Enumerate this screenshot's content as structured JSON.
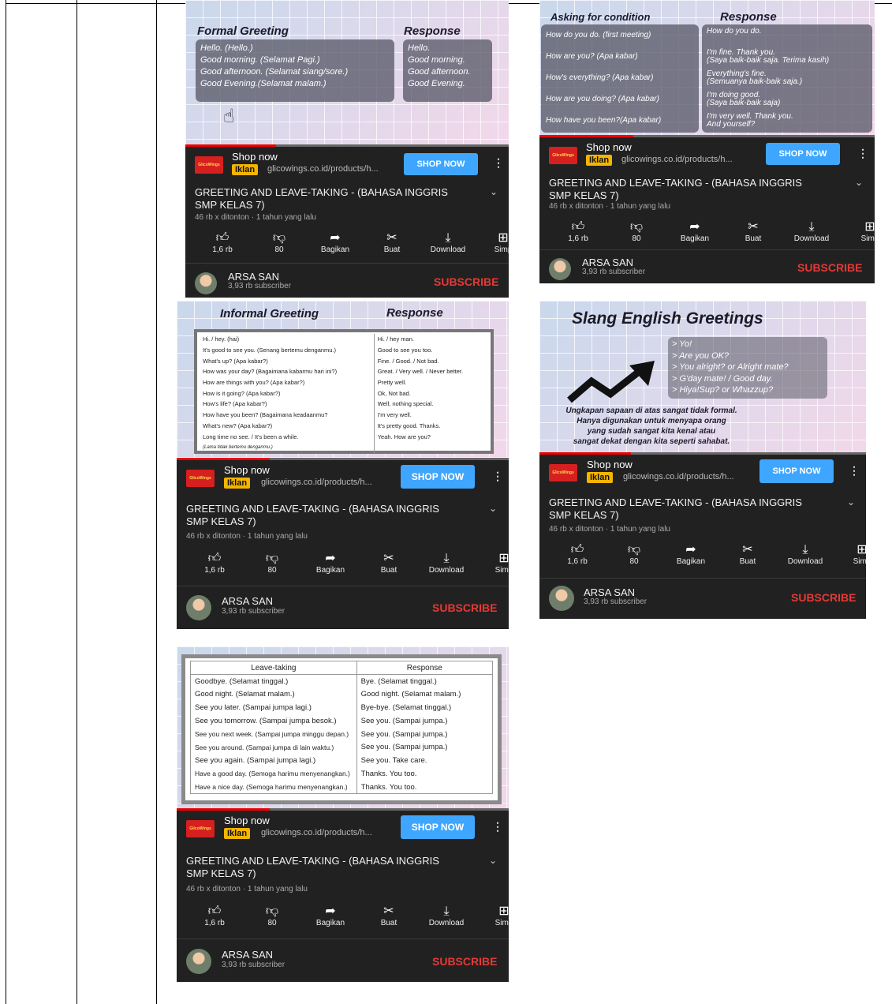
{
  "ad": {
    "shop_now": "Shop now",
    "badge": "Iklan",
    "url": "glicowings.co.id/products/h...",
    "button": "SHOP NOW",
    "logo_text": "GlicoWings"
  },
  "video": {
    "title": "GREETING  AND LEAVE-TAKING - (BAHASA INGGRIS SMP KELAS 7)",
    "meta": "46 rb x ditonton · 1 tahun yang lalu",
    "actions": [
      {
        "icon": "thumbs-up-icon",
        "label": "1,6 rb"
      },
      {
        "icon": "thumbs-down-icon",
        "label": "80"
      },
      {
        "icon": "share-icon",
        "label": "Bagikan"
      },
      {
        "icon": "remix-icon",
        "label": "Buat"
      },
      {
        "icon": "download-icon",
        "label": "Download"
      },
      {
        "icon": "save-icon",
        "label": "Simp"
      }
    ]
  },
  "channel": {
    "name": "ARSA SAN",
    "subscribers": "3,93 rb subscriber",
    "subscribe": "SUBSCRIBE"
  },
  "thumbs": {
    "formal": {
      "heading": "Formal Greeting",
      "response_heading": "Response",
      "greetings": [
        "Hello. (Hello.)",
        "Good morning. (Selamat Pagi.)",
        "Good afternoon. (Selamat siang/sore.)",
        "Good Evening.(Selamat malam.)"
      ],
      "responses": [
        "Hello.",
        "Good morning.",
        "Good afternoon.",
        "Good Evening."
      ]
    },
    "condition": {
      "heading": "Asking for condition",
      "response_heading": "Response",
      "asks": [
        "How do you do. (first meeting)",
        "How are you? (Apa kabar)",
        "How's everything? (Apa kabar)",
        "How are you doing? (Apa kabar)",
        "How have you been?(Apa kabar)"
      ],
      "answers": [
        [
          "How do you do.",
          ""
        ],
        [
          "I'm fine. Thank you.",
          "(Saya baik-baik saja. Terima kasih)"
        ],
        [
          "Everything's fine.",
          "(Semuanya baik-baik saja.)"
        ],
        [
          "I'm doing good.",
          "(Saya baik-baik saja)"
        ],
        [
          "I'm very well. Thank you.",
          "And yourself?"
        ]
      ]
    },
    "informal": {
      "heading": "Informal Greeting",
      "response_heading": "Response",
      "rows": [
        [
          "Hi. / hey. (hai)",
          "Hi. / hey man."
        ],
        [
          "It's good to see you. (Senang bertemu denganmu.)",
          "Good to see you too."
        ],
        [
          "What's up? (Apa kabar?)",
          "Fine. / Good. / Not bad."
        ],
        [
          "How was your day? (Bagaimana kabarmu hari ini?)",
          "Great. / Very well. / Never better."
        ],
        [
          "How are things with you? (Apa kabar?)",
          "Pretty well."
        ],
        [
          "How is it going? (Apa kabar?)",
          "Ok, Not bad."
        ],
        [
          "How's life? (Apa kabar?)",
          "Well, nothing special."
        ],
        [
          "How have you been? (Bagaimana keadaanmu?",
          "I'm very well."
        ],
        [
          "What's new? (Apa kabar?)",
          "It's pretty good. Thanks."
        ],
        [
          "Long time no see. / It's been a while.",
          "Yeah. How are you?"
        ],
        [
          "(Lama tidak bertemu denganmu.)",
          ""
        ]
      ]
    },
    "slang": {
      "heading": "Slang English Greetings",
      "items": [
        "> Yo!",
        "> Are you OK?",
        "> You alright? or Alright mate?",
        "> G'day mate! / Good day.",
        "> Hiya!Sup? or Whazzup?"
      ],
      "note": [
        "Ungkapan sapaan di atas sangat tidak formal.",
        "Hanya digunakan untuk menyapa orang",
        "yang sudah sangat kita kenal atau",
        "sangat dekat dengan kita seperti sahabat."
      ]
    },
    "leave": {
      "col1": "Leave-taking",
      "col2": "Response",
      "rows": [
        [
          "Goodbye. (Selamat tinggal.)",
          "Bye. (Selamat tinggal.)"
        ],
        [
          "Good night. (Selamat malam.)",
          "Good night. (Selamat malam.)"
        ],
        [
          "See you later. (Sampai jumpa lagi.)",
          "Bye-bye. (Selamat tinggal.)"
        ],
        [
          "See you tomorrow. (Sampai jumpa besok.)",
          "See you. (Sampai jumpa.)"
        ],
        [
          "See you next week. (Sampai jumpa minggu depan.)",
          "See you. (Sampai jumpa.)"
        ],
        [
          "See you around. (Sampai jumpa di lain waktu.)",
          "See you. (Sampai jumpa.)"
        ],
        [
          "See you again. (Sampai jumpa lagi.)",
          "See you. Take care."
        ],
        [
          "Have a good day. (Semoga harimu menyenangkan.)",
          "Thanks. You too."
        ],
        [
          "Have a nice day. (Semoga harimu menyenangkan.)",
          "Thanks. You too."
        ]
      ]
    }
  }
}
